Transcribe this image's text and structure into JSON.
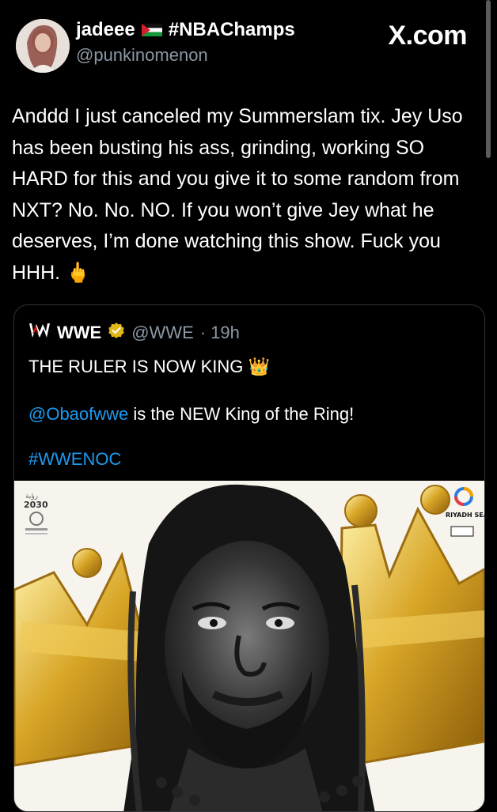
{
  "tweet": {
    "author_name": "jadeee",
    "author_flag": "palestine-flag",
    "author_hashtag": "#NBAChamps",
    "handle": "@punkinomenon",
    "source": "X.com",
    "text": "Anddd I just canceled my Summerslam tix. Jey Uso has been busting his ass, grinding, working SO HARD for this and you give it to some random from NXT? No. No. NO. If you won’t give Jey what he deserves, I’m done watching this show. Fuck you HHH. 🖕"
  },
  "quote": {
    "name": "WWE",
    "handle": "@WWE",
    "time": "· 19h",
    "line1": "THE RULER IS NOW KING 👑",
    "mention": "@Obaofwwe",
    "line2_rest": " is the NEW King of the Ring!",
    "hashtag": "#WWENOC",
    "media_left_badge": "2030",
    "media_right_badge": "RIYADH SEASON"
  },
  "colors": {
    "background": "#000000",
    "link": "#1d9bf0",
    "muted": "#8b98a5",
    "verified": "#e2b719"
  }
}
